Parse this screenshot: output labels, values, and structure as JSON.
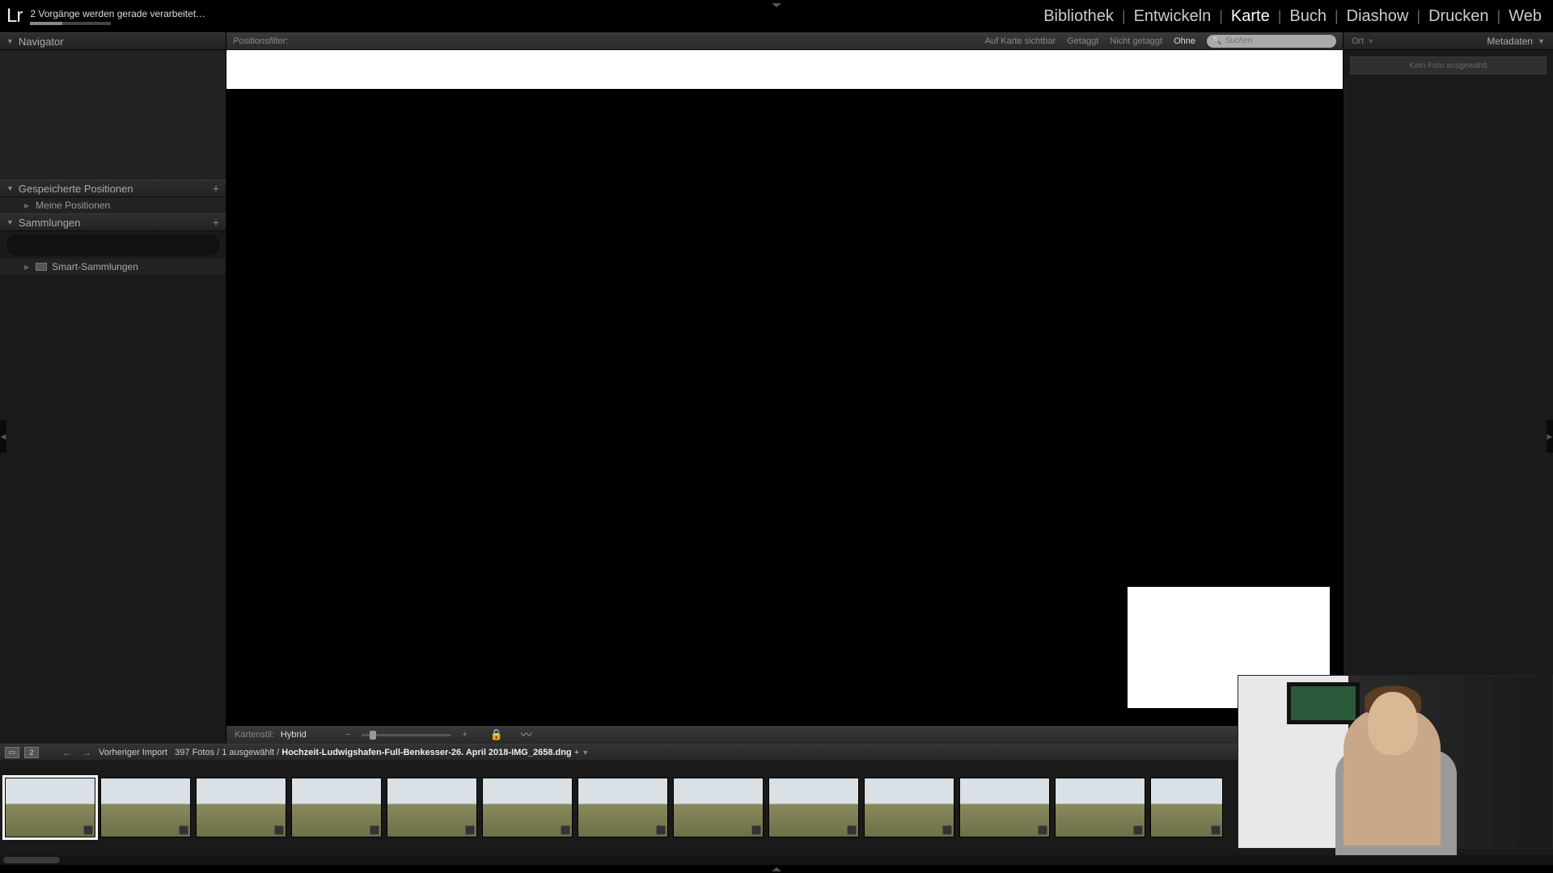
{
  "app": {
    "logo": "Lr",
    "processing": "2 Vorgänge werden gerade verarbeitet…"
  },
  "modules": {
    "items": [
      "Bibliothek",
      "Entwickeln",
      "Karte",
      "Buch",
      "Diashow",
      "Drucken",
      "Web"
    ],
    "active_index": 2
  },
  "left": {
    "navigator": "Navigator",
    "saved": {
      "title": "Gespeicherte Positionen",
      "item": "Meine Positionen"
    },
    "collections": {
      "title": "Sammlungen",
      "smart": "Smart-Sammlungen"
    }
  },
  "filter": {
    "label": "Positionsfilter:",
    "opts": [
      "Auf Karte sichtbar",
      "Getaggt",
      "Nicht getaggt",
      "Ohne"
    ],
    "search_placeholder": "Suchen"
  },
  "map_toolbar": {
    "style_label": "Kartenstil:",
    "style_value": "Hybrid",
    "minus": "−",
    "plus": "+"
  },
  "right": {
    "ort": "Ort",
    "metadata": "Metadaten",
    "none_selected": "Kein Foto ausgewählt"
  },
  "filmstrip_bar": {
    "second_view": "2",
    "prev": "Vorheriger Import",
    "count": "397 Fotos",
    "selected": "1 ausgewählt",
    "path": "Hochzeit-Ludwigshafen-Full-Benkesser-26. April 2018-IMG_2658.dng",
    "dirty": "+"
  },
  "thumbs": {
    "count": 13,
    "selected_index": 0
  }
}
